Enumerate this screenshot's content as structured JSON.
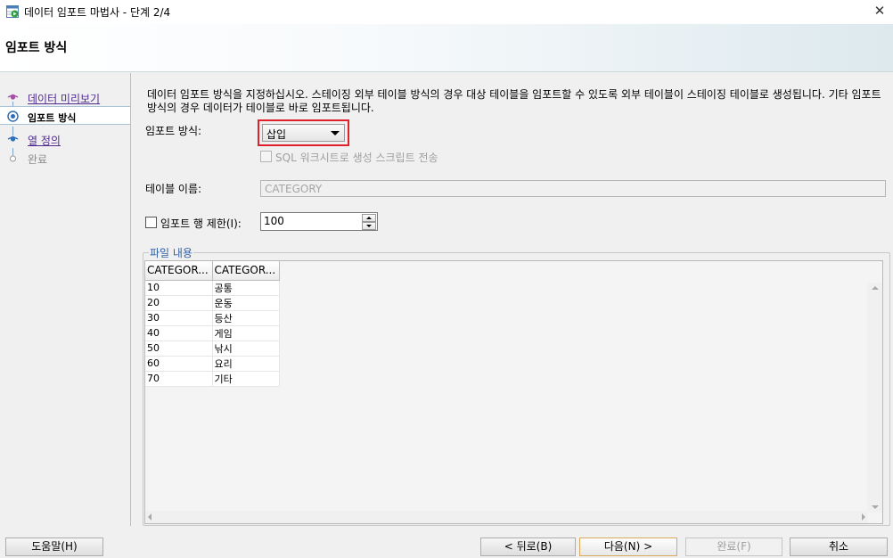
{
  "window": {
    "title": "데이터 임포트 마법사 - 단계 2/4",
    "close_glyph": "✕",
    "app_icon": "import-wizard-icon"
  },
  "header": {
    "title": "임포트 방식"
  },
  "steps": [
    {
      "label": "데이터 미리보기",
      "state": "link"
    },
    {
      "label": "임포트 방식",
      "state": "active"
    },
    {
      "label": "열 정의",
      "state": "link"
    },
    {
      "label": "완료",
      "state": "disabled"
    }
  ],
  "main": {
    "description": "데이터 임포트 방식을 지정하십시오. 스테이징 외부 테이블 방식의 경우 대상 테이블을 임포트할 수 있도록 외부 테이블이 스테이징 테이블로 생성됩니다. 기타 임포트 방식의 경우 데이터가 테이블로 바로 임포트됩니다.",
    "import_method": {
      "label": "임포트 방식:",
      "value": "삽입"
    },
    "sql_script": {
      "label": "SQL 워크시트로 생성 스크립트 전송",
      "checked": false,
      "enabled": false
    },
    "table_name": {
      "label": "테이블 이름:",
      "value": "CATEGORY"
    },
    "row_limit": {
      "label": "임포트 행 제한(I):",
      "checked": false,
      "value": "100"
    },
    "file_content": {
      "legend": "파일 내용",
      "columns": [
        "CATEGOR...",
        "CATEGOR..."
      ],
      "rows": [
        [
          "10",
          "공통"
        ],
        [
          "20",
          "운동"
        ],
        [
          "30",
          "등산"
        ],
        [
          "40",
          "게임"
        ],
        [
          "50",
          "낚시"
        ],
        [
          "60",
          "요리"
        ],
        [
          "70",
          "기타"
        ]
      ]
    }
  },
  "buttons": {
    "help": "도움말(H)",
    "back": "< 뒤로(B)",
    "next": "다음(N) >",
    "finish": "완료(F)",
    "cancel": "취소"
  },
  "colors": {
    "highlight_frame": "#e0202a",
    "link": "#4f2a8e",
    "legend": "#2f5fa3"
  }
}
